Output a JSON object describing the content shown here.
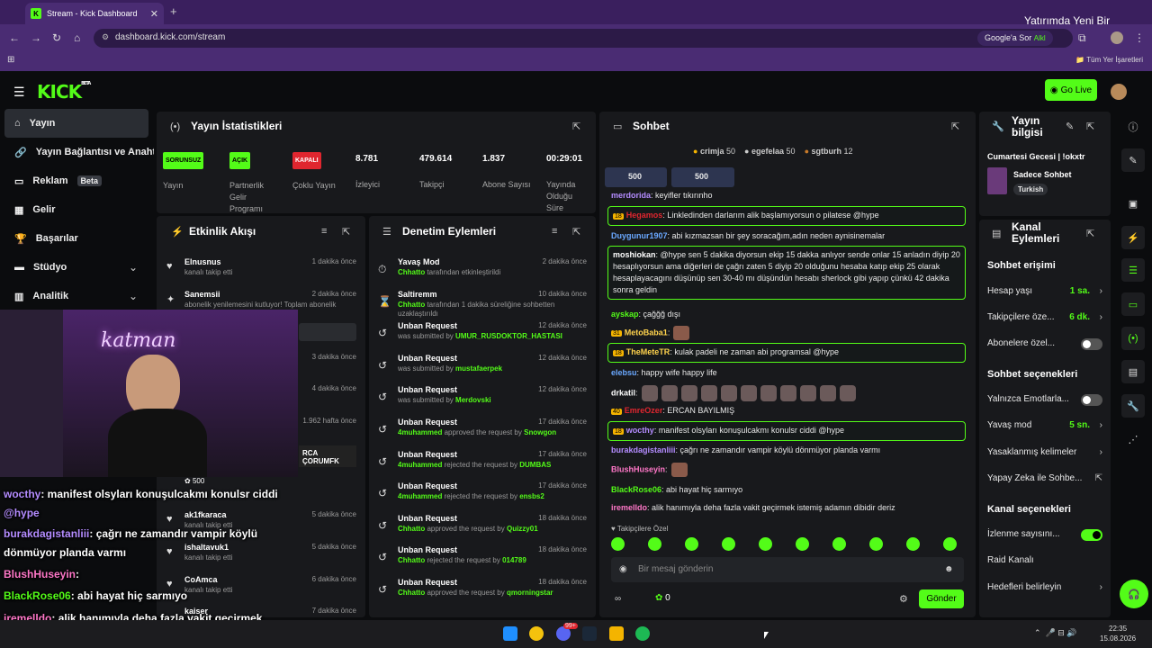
{
  "browser": {
    "tab_title": "Stream - Kick Dashboard",
    "url": "dashboard.kick.com/stream",
    "google_btn": "Google'a Sor",
    "bookmarks_label": "Tüm Yer İşaretleri",
    "overlay_text": "Yatırımda Yeni Bir",
    "overlay_small": "Alkl"
  },
  "header": {
    "logo": "KICK",
    "logo_sup": "BETA",
    "go_live": "Go Live"
  },
  "sidebar": {
    "items": [
      {
        "label": "Yayın"
      },
      {
        "label": "Yayın Bağlantısı ve Anahtarı"
      },
      {
        "label": "Reklam",
        "badge": "Beta"
      },
      {
        "label": "Gelir"
      },
      {
        "label": "Başarılar"
      },
      {
        "label": "Stüdyo"
      },
      {
        "label": "Analitik"
      }
    ]
  },
  "stats": {
    "title": "Yayın İstatistikleri",
    "cols": [
      {
        "badge": "SORUNSUZ",
        "badge_color": "#53fc18",
        "label": "Yayın"
      },
      {
        "badge": "AÇIK",
        "badge_color": "#53fc18",
        "label": "Partnerlik Gelir Programı"
      },
      {
        "badge": "KAPALI",
        "badge_color": "#e0262f",
        "label": "Çoklu Yayın"
      },
      {
        "value": "8.781",
        "label": "İzleyici"
      },
      {
        "value": "479.614",
        "label": "Takipçi"
      },
      {
        "value": "1.837",
        "label": "Abone Sayısı"
      },
      {
        "value": "00:29:01",
        "label": "Yayında Olduğu Süre"
      }
    ]
  },
  "events": {
    "title": "Etkinlik Akışı",
    "items": [
      {
        "name": "Elnusnus",
        "sub": "kanalı takip etti",
        "time": "1 dakika önce"
      },
      {
        "name": "Sanemsii",
        "sub": "abonelik yenilemesini kutluyor! Toplam abonelik",
        "time": "2 dakika önce"
      },
      {
        "time": "3 dakika önce"
      },
      {
        "time": "4 dakika önce"
      },
      {
        "time": "1.962 hafta önce"
      },
      {
        "name": "RCA ÇORUMFK",
        "coins": "500"
      },
      {
        "name": "ak1fkaraca",
        "sub": "kanalı takip etti",
        "time": "5 dakika önce"
      },
      {
        "name": "ishaltavuk1",
        "sub": "kanalı takip etti",
        "time": "5 dakika önce"
      },
      {
        "name": "CoAmca",
        "sub": "kanalı takip etti",
        "time": "6 dakika önce"
      },
      {
        "name": "kaiser",
        "time": "7 dakika önce"
      }
    ]
  },
  "moderation": {
    "title": "Denetim Eylemleri",
    "items": [
      {
        "name": "Yavaş Mod",
        "actor": "Chhatto",
        "rest": "tarafından etkinleştirildi",
        "time": "2 dakika önce"
      },
      {
        "name": "Saltiremm",
        "actor": "Chhatto",
        "rest": "tarafından 1 dakika süreliğine sohbetten uzaklaştırıldı",
        "time": "10 dakika önce"
      },
      {
        "name": "Unban Request",
        "pre": "was submitted by",
        "actor": "UMUR_RUSDOKTOR_HASTASI",
        "time": "12 dakika önce"
      },
      {
        "name": "Unban Request",
        "pre": "was submitted by",
        "actor": "mustafaerpek",
        "time": "12 dakika önce"
      },
      {
        "name": "Unban Request",
        "pre": "was submitted by",
        "actor": "Merdovski",
        "time": "12 dakika önce"
      },
      {
        "name": "Unban Request",
        "actor": "4muhammed",
        "rest": "approved the request by",
        "target": "Snowgon",
        "time": "17 dakika önce"
      },
      {
        "name": "Unban Request",
        "actor": "4muhammed",
        "rest": "rejected the request by",
        "target": "DUMBAS",
        "time": "17 dakika önce"
      },
      {
        "name": "Unban Request",
        "actor": "4muhammed",
        "rest": "rejected the request by",
        "target": "ensbs2",
        "time": "17 dakika önce"
      },
      {
        "name": "Unban Request",
        "actor": "Chhatto",
        "rest": "approved the request by",
        "target": "Quizzy01",
        "time": "18 dakika önce"
      },
      {
        "name": "Unban Request",
        "actor": "Chhatto",
        "rest": "rejected the request by",
        "target": "014789",
        "time": "18 dakika önce"
      },
      {
        "name": "Unban Request",
        "actor": "Chhatto",
        "rest": "approved the request by",
        "target": "qmorningstar",
        "time": "18 dakika önce"
      }
    ]
  },
  "chat": {
    "title": "Sohbet",
    "leaders": [
      {
        "name": "crimja",
        "n": "50"
      },
      {
        "name": "egefelaa",
        "n": "50"
      },
      {
        "name": "sgtburh",
        "n": "12"
      }
    ],
    "pins": [
      "500",
      "500"
    ],
    "lines": [
      {
        "user": "merdorida",
        "color": "#b48cff",
        "text": ": keyifler tıkırınho"
      },
      {
        "box": true,
        "user": "Hegamos",
        "color": "#e0262f",
        "text": ": Linkledinden darlarım alik başlamıyorsun o pilatese @hype",
        "tag": "18"
      },
      {
        "user": "Duygunur1907",
        "color": "#6aa8ff",
        "text": ": abi kızmazsan bir şey soracağım,adın neden aynisinemalar"
      },
      {
        "box": true,
        "user": "moshiokan",
        "color": "#ffffff",
        "text": ": @hype sen 5 dakika diyorsun ekip 15 dakka anlıyor sende onlar 15 anladın diyip 20 hesaplıyorsun ama diğerleri de çağrı zaten 5 diyip 20 olduğunu hesaba katıp ekip 25 olarak hesaplayacagını düşünüp sen 30-40 mı düşündün hesabı sherlock gibi yapıp çünkü 42 dakika sonra geldin"
      },
      {
        "user": "ayskap",
        "color": "#53fc18",
        "text": ": çağğğ dışı"
      },
      {
        "user": "MetoBaba1",
        "color": "#ffd34d",
        "text": ":",
        "tag": "31"
      },
      {
        "box": true,
        "user": "TheMeteTR",
        "color": "#ffd34d",
        "text": ": kulak padeli ne zaman abi programsal @hype",
        "tag": "18"
      },
      {
        "user": "elebsu",
        "color": "#6aa8ff",
        "text": ": happy wife happy life"
      },
      {
        "user": "drkatil",
        "color": "#ffffff",
        "text": ":"
      },
      {
        "user": "EmreOzer",
        "color": "#e0262f",
        "text": ": ERCAN BAYILMIŞ",
        "tag": "40"
      },
      {
        "box": true,
        "user": "wocthy",
        "color": "#b48cff",
        "text": ": manifest olsyları konuşulcakmı konulsr ciddi @hype",
        "tag": "18"
      },
      {
        "user": "burakdagistanliii",
        "color": "#b48cff",
        "text": ": çağrı ne zamandır vampir köylü dönmüyor planda varmı"
      },
      {
        "user": "BlushHuseyin",
        "color": "#ff77c8",
        "text": ":"
      },
      {
        "user": "BlackRose06",
        "color": "#53fc18",
        "text": ": abi hayat hiç sarmıyo"
      },
      {
        "user": "iremelldo",
        "color": "#ff77c8",
        "text": ": alik hanımıyla deha fazla vakit geçirmek istemiş adamın dibidir deriz"
      }
    ],
    "followers_only": "Takipçilere Özel",
    "placeholder": "Bir mesaj gönderin",
    "send": "Gönder",
    "points": "0"
  },
  "stream_info": {
    "title": "Yayın bilgisi",
    "stream_title": "Cumartesi Gecesi | !okxtr",
    "category": "Sadece Sohbet",
    "tag": "Turkish"
  },
  "channel": {
    "title": "Kanal Eylemleri",
    "access_head": "Sohbet erişimi",
    "rows1": [
      {
        "label": "Hesap yaşı",
        "value": "1 sa."
      },
      {
        "label": "Takipçilere öze...",
        "value": "6 dk."
      },
      {
        "label": "Abonelere özel...",
        "toggle": "off"
      }
    ],
    "options_head": "Sohbet seçenekleri",
    "rows2": [
      {
        "label": "Yalnızca Emotlarla...",
        "toggle": "off"
      },
      {
        "label": "Yavaş mod",
        "value": "5 sn."
      },
      {
        "label": "Yasaklanmış kelimeler"
      },
      {
        "label": "Yapay Zeka ile Sohbe..."
      }
    ],
    "channel_head": "Kanal seçenekleri",
    "rows3": [
      {
        "label": "İzlenme sayısını...",
        "toggle": "on"
      },
      {
        "label": "Raid Kanalı"
      },
      {
        "label": "Hedefleri belirleyin"
      }
    ]
  },
  "overlay_chat": [
    {
      "user": "wocthy",
      "color": "#b48cff",
      "text": ": manifest olsyları konuşulcakmı konulsr ciddi"
    },
    {
      "text": "@hype",
      "color": "#b48cff"
    },
    {
      "user": "burakdagistanliii",
      "color": "#b48cff",
      "text": ": çağrı ne zamandır vampir köylü"
    },
    {
      "text": "dönmüyor planda varmı",
      "color": "#fff"
    },
    {
      "user": "BlushHuseyin",
      "color": "#ff77c8",
      "text": ":"
    },
    {
      "user": "BlackRose06",
      "color": "#53fc18",
      "text": ": abi hayat hiç sarmıyo"
    },
    {
      "user": "iremelldo",
      "color": "#ff77c8",
      "text": ": alik hanımıyla deha fazla vakit geçirmek"
    },
    {
      "text": "istemiş adamın dibidir deriz",
      "color": "#fff"
    }
  ],
  "webcam": {
    "neon": "katman"
  },
  "taskbar": {
    "time": "22:35",
    "date": "15.08.2026",
    "badge": "99+"
  }
}
